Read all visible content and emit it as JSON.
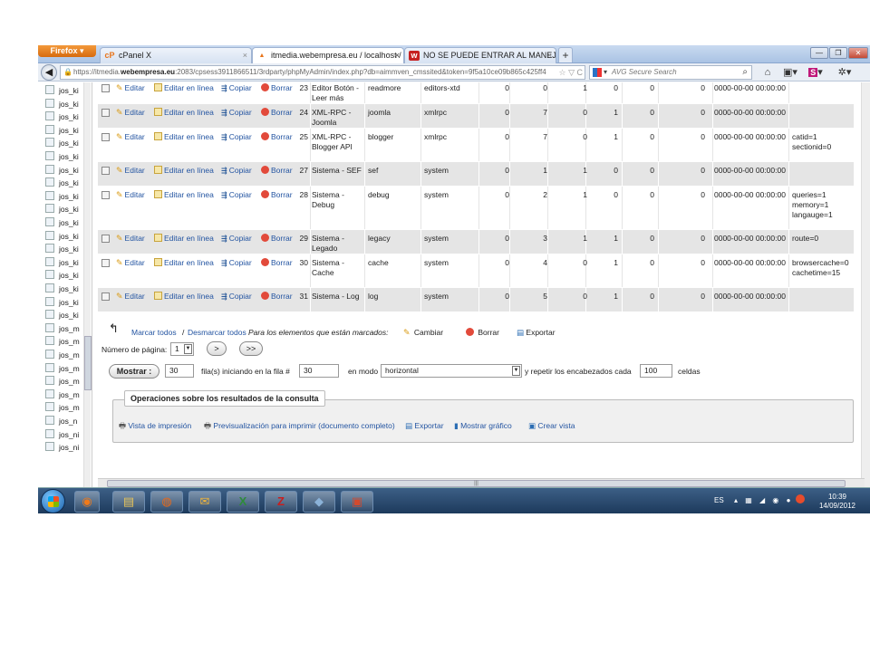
{
  "browser": {
    "firefox_label": "Firefox",
    "tabs": [
      {
        "label": "cPanel X",
        "icon": "cP"
      },
      {
        "label": "itmedia.webempresa.eu / localhost / ...",
        "icon": "pma"
      },
      {
        "label": "NO SE PUEDE ENTRAR AL MANEJAD...",
        "icon": "w"
      }
    ],
    "url_prefix": "https://itmedia.",
    "url_domain": "webempresa.eu",
    "url_rest": ":2083/cpsess3911866511/3rdparty/phpMyAdmin/index.php?db=aimmven_cmssited&token=9f5a10ce09b865c425ff4",
    "search_placeholder": "AVG Secure Search"
  },
  "sidebar": {
    "items": [
      "jos_ki",
      "jos_ki",
      "jos_ki",
      "jos_ki",
      "jos_ki",
      "jos_ki",
      "jos_ki",
      "jos_ki",
      "jos_ki",
      "jos_ki",
      "jos_ki",
      "jos_ki",
      "jos_ki",
      "jos_ki",
      "jos_ki",
      "jos_ki",
      "jos_ki",
      "jos_ki",
      "jos_m",
      "jos_m",
      "jos_m",
      "jos_m",
      "jos_m",
      "jos_m",
      "jos_m",
      "jos_n",
      "jos_ni",
      "jos_ni"
    ]
  },
  "actions": {
    "edit": "Editar",
    "edit_inline": "Editar en línea",
    "copy": "Copiar",
    "delete": "Borrar"
  },
  "rows": [
    {
      "id": "23",
      "name": "Editor Botón - Leer más",
      "element": "readmore",
      "folder": "editors-xtd",
      "c1": "0",
      "c2": "0",
      "c3": "1",
      "c4": "0",
      "c5": "0",
      "c6": "0",
      "checked_out_time": "0000-00-00 00:00:00",
      "params": ""
    },
    {
      "id": "24",
      "name": "XML-RPC - Joomla",
      "element": "joomla",
      "folder": "xmlrpc",
      "c1": "0",
      "c2": "7",
      "c3": "0",
      "c4": "1",
      "c5": "0",
      "c6": "0",
      "checked_out_time": "0000-00-00 00:00:00",
      "params": ""
    },
    {
      "id": "25",
      "name": "XML-RPC - Blogger API",
      "element": "blogger",
      "folder": "xmlrpc",
      "c1": "0",
      "c2": "7",
      "c3": "0",
      "c4": "1",
      "c5": "0",
      "c6": "0",
      "checked_out_time": "0000-00-00 00:00:00",
      "params": "catid=1 sectionid=0"
    },
    {
      "id": "27",
      "name": "Sistema - SEF",
      "element": "sef",
      "folder": "system",
      "c1": "0",
      "c2": "1",
      "c3": "1",
      "c4": "0",
      "c5": "0",
      "c6": "0",
      "checked_out_time": "0000-00-00 00:00:00",
      "params": ""
    },
    {
      "id": "28",
      "name": "Sistema - Debug",
      "element": "debug",
      "folder": "system",
      "c1": "0",
      "c2": "2",
      "c3": "1",
      "c4": "0",
      "c5": "0",
      "c6": "0",
      "checked_out_time": "0000-00-00 00:00:00",
      "params": "queries=1 memory=1 langauge=1"
    },
    {
      "id": "29",
      "name": "Sistema - Legado",
      "element": "legacy",
      "folder": "system",
      "c1": "0",
      "c2": "3",
      "c3": "1",
      "c4": "1",
      "c5": "0",
      "c6": "0",
      "checked_out_time": "0000-00-00 00:00:00",
      "params": "route=0"
    },
    {
      "id": "30",
      "name": "Sistema - Cache",
      "element": "cache",
      "folder": "system",
      "c1": "0",
      "c2": "4",
      "c3": "0",
      "c4": "1",
      "c5": "0",
      "c6": "0",
      "checked_out_time": "0000-00-00 00:00:00",
      "params": "browsercache=0 cachetime=15"
    },
    {
      "id": "31",
      "name": "Sistema - Log",
      "element": "log",
      "folder": "system",
      "c1": "0",
      "c2": "5",
      "c3": "0",
      "c4": "1",
      "c5": "0",
      "c6": "0",
      "checked_out_time": "0000-00-00 00:00:00",
      "params": ""
    }
  ],
  "bulk": {
    "mark_all": "Marcar todos",
    "separator": "/",
    "unmark_all": "Desmarcar todos",
    "for_selected": "Para los elementos que están marcados:",
    "change": "Cambiar",
    "delete": "Borrar",
    "export": "Exportar"
  },
  "paging": {
    "page_label": "Número de página:",
    "page_value": "1",
    "next": ">",
    "last": ">>"
  },
  "show": {
    "button": "Mostrar :",
    "rows_value": "30",
    "rows_label": "fila(s) iniciando en la fila #",
    "start_value": "30",
    "mode_label": "en modo",
    "mode_value": "horizontal",
    "repeat_label": "y repetir los encabezados cada",
    "repeat_value": "100",
    "cells_label": "celdas"
  },
  "ops": {
    "legend": "Operaciones sobre los resultados de la consulta",
    "print_view": "Vista de impresión",
    "print_preview": "Previsualización para imprimir (documento completo)",
    "export": "Exportar",
    "chart": "Mostrar gráfico",
    "create_view": "Crear vista"
  },
  "taskbar": {
    "lang": "ES",
    "time": "10:39",
    "date": "14/09/2012"
  },
  "colors": {
    "link": "#2354a1",
    "row_alt": "#e5e5e5",
    "taskbar": "#1d3a5c"
  }
}
